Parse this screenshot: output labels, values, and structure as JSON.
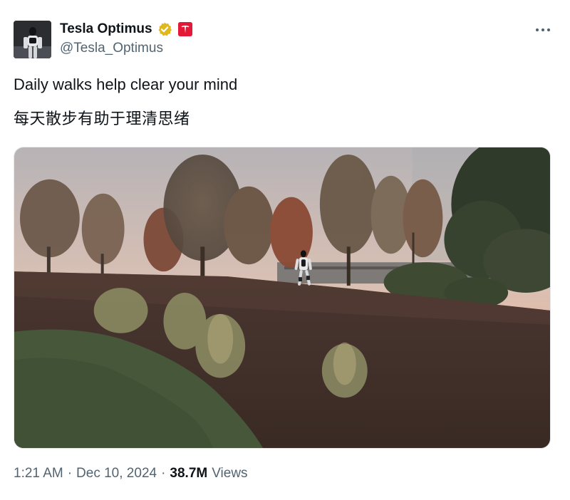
{
  "author": {
    "display_name": "Tesla Optimus",
    "handle": "@Tesla_Optimus",
    "verified_badge_color": "#e2b719",
    "affiliate_badge_color": "#e31937",
    "affiliate_badge_icon": "tesla-logo-icon"
  },
  "more_icon": "more-horizontal-icon",
  "tweet": {
    "text_en": "Daily walks help clear your mind",
    "text_zh": "每天散步有助于理清思绪"
  },
  "media": {
    "type": "video",
    "subject": "tesla-optimus-robot-walking-hillside"
  },
  "meta": {
    "time": "1:21 AM",
    "separator": "·",
    "date": "Dec 10, 2024",
    "views_count": "38.7M",
    "views_label": "Views"
  },
  "colors": {
    "text_primary": "#0f1419",
    "text_secondary": "#536471"
  }
}
